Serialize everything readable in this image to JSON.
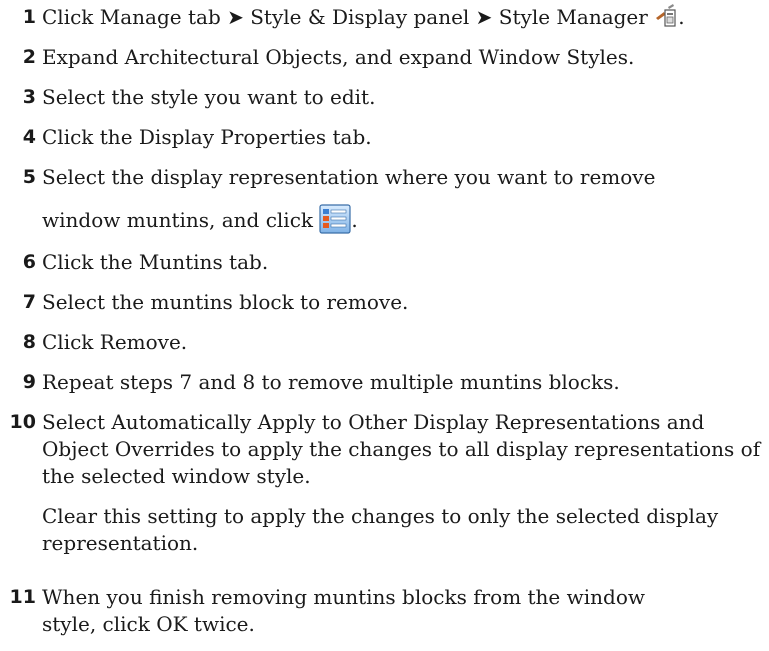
{
  "steps": [
    {
      "num": "1",
      "text": "Click Manage tab ➤ Style & Display panel ➤ Style Manager",
      "icon": "style-manager-icon",
      "after_icon": "."
    },
    {
      "num": "2",
      "text": "Expand Architectural Objects, and expand Window Styles."
    },
    {
      "num": "3",
      "text": "Select the style you want to edit."
    },
    {
      "num": "4",
      "text": "Click the Display Properties tab."
    },
    {
      "num": "5",
      "line1": "Select the display representation where you want to remove",
      "line2": "window muntins, and click",
      "icon": "edit-display-properties-icon",
      "after_icon": "."
    },
    {
      "num": "6",
      "text": "Click the Muntins tab."
    },
    {
      "num": "7",
      "text": "Select the muntins block to remove."
    },
    {
      "num": "8",
      "text": "Click Remove."
    },
    {
      "num": "9",
      "text": "Repeat steps 7 and 8 to remove multiple muntins blocks."
    },
    {
      "num": "10",
      "text": "Select Automatically Apply to Other Display Representations and Object Overrides to apply the changes to all display representations of the selected window style.",
      "note": "Clear this setting to apply the changes to only the selected display representation."
    },
    {
      "num": "11",
      "text": "When you finish removing muntins blocks from the window style, click OK twice."
    }
  ]
}
